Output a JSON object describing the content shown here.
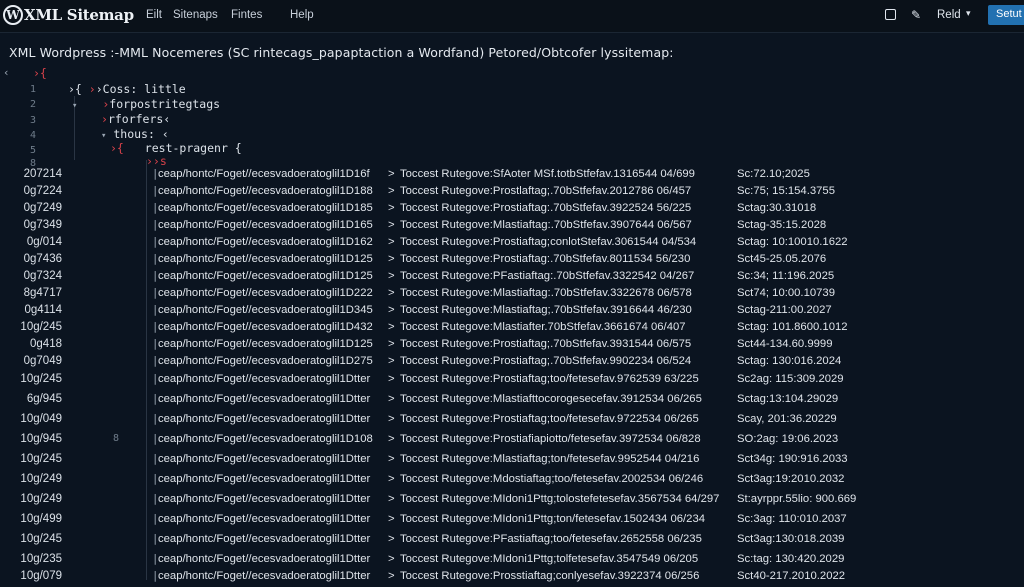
{
  "app": {
    "logo": "W",
    "title": "XML Sitemap"
  },
  "menu": [
    "Eilt",
    "Sitenaps",
    "Fintes",
    "Help"
  ],
  "toolbar": {
    "square_icon": "square-icon",
    "edit_icon": "pencil-icon",
    "read_label": "Reld",
    "caret": "▾",
    "primary_label": "Setut"
  },
  "subtitle": "XML Wordpress :-MML Nocemeres (SC rintecags_papaptaction a Wordfand) Petored/Obtcofer lyssitemap:",
  "tree": {
    "back": "‹",
    "lines": [
      {
        "num": "",
        "pre": "",
        "red": "›{",
        "text": ""
      },
      {
        "num": "1",
        "pre": "›{  ",
        "red": "›",
        "text": "›Coss: little"
      },
      {
        "num": "2",
        "pre": "",
        "red": "›",
        "text": "forpostritegtags"
      },
      {
        "num": "3",
        "pre": "",
        "red": "›",
        "text": "rforfers‹"
      },
      {
        "num": "4",
        "pre": "",
        "red": "",
        "text": "thous: ‹"
      },
      {
        "num": "5",
        "pre": "",
        "red": "›{",
        "text": "rest-pragenr {"
      },
      {
        "num": "8",
        "pre": "",
        "red": "››s",
        "text": ""
      }
    ]
  },
  "rows": [
    {
      "id": "207214",
      "path": "ceap/hontc/Foget//ecesvadoeratoglil1D16f",
      "desc": "Toccest Rutegove:SfAoter MSf.totbStfefav.1316544 04/699",
      "date": "Sc:72.10;2025"
    },
    {
      "id": "0g7224",
      "path": "ceap/hontc/Foget//ecesvadoeratoglil1D188",
      "desc": "Toccest Rutegove:Prostlaftag;.70bStfefav.2012786 06/457",
      "date": "Sc:75; 15:154.3755"
    },
    {
      "id": "0g7249",
      "path": "ceap/hontc/Foget//ecesvadoeratoglil1D185",
      "desc": "Toccest Rutegove:Prostiaftag:.70bStfefav.3922524 56/225",
      "date": "Sctag:30.31018"
    },
    {
      "id": "0g7349",
      "path": "ceap/hontc/Foget//ecesvadoeratoglil1D165",
      "desc": "Toccest Rutegove:Mlastiaftag:.70bStfefav.3907644 06/567",
      "date": "Sctag-35:15.2028"
    },
    {
      "id": "0g/014",
      "path": "ceap/hontc/Foget//ecesvadoeratoglil1D162",
      "desc": "Toccest Rutegove:Prostiaftag;conlotStefav.3061544 04/534",
      "date": "Sctag: 10:10010.1622"
    },
    {
      "id": "0g7436",
      "path": "ceap/hontc/Foget//ecesvadoeratoglil1D125",
      "desc": "Toccest Rutegove:Prostiaftag:.70bStfefav.8011534 56/230",
      "date": "Sct45-25.05.2076"
    },
    {
      "id": "0g7324",
      "path": "ceap/hontc/Foget//ecesvadoeratoglil1D125",
      "desc": "Toccest Rutegove:PFastiaftag:.70bStfefav.3322542 04/267",
      "date": "Sc:34; 11:196.2025"
    },
    {
      "id": "8g4717",
      "path": "ceap/hontc/Foget//ecesvadoeratoglil1D222",
      "desc": "Toccest Rutegove:Mlastiaftag:.70bStfefav.3322678 06/578",
      "date": "Sct74; 10:00.10739"
    },
    {
      "id": "0g4114",
      "path": "ceap/hontc/Foget//ecesvadoeratoglil1D345",
      "desc": "Toccest Rutegove:Mlastiaftag;.70bStfefav.3916644 46/230",
      "date": "Sctag-211:00.2027"
    },
    {
      "id": "10g/245",
      "path": "ceap/hontc/Foget//ecesvadoeratoglil1D432",
      "desc": "Toccest Rutegove:Mlastiafter.70bStfefav.3661674 06/407",
      "date": "Sctag: 101.8600.1012"
    },
    {
      "id": "0g418",
      "path": "ceap/hontc/Foget//ecesvadoeratoglil1D125",
      "desc": "Toccest Rutegove:Prostiaftag;.70bStfefav.3931544 06/575",
      "date": "Sct44-134.60.9999"
    },
    {
      "id": "0g7049",
      "path": "ceap/hontc/Foget//ecesvadoeratoglil1D275",
      "desc": "Toccest Rutegove:Prostiaftag;.70bStfefav.9902234 06/524",
      "date": "Sctag: 130:016.2024"
    },
    {
      "id": "10g/245",
      "path": "ceap/hontc/Foget//ecesvadoeratoglil1Dtter",
      "desc": "Toccest Rutegove:Prostiaftag;too/fetesefav.9762539 63/225",
      "date": "Sc2ag: 115:309.2029"
    },
    {
      "id": "6g/945",
      "path": "ceap/hontc/Foget//ecesvadoeratoglil1Dtter",
      "desc": "Toccest Rutegove:Mlastiafttocorogesecefav.3912534 06/265",
      "date": "Sctag:13:104.29029"
    },
    {
      "id": "10g/049",
      "path": "ceap/hontc/Foget//ecesvadoeratoglil1Dtter",
      "desc": "Toccest Rutegove:Prostiaftag;too/fetesefav.9722534 06/265",
      "date": "Scay, 201:36.20229"
    },
    {
      "id": "10g/945",
      "path": "ceap/hontc/Foget//ecesvadoeratoglil1D108",
      "desc": "Toccest Rutegove:Prostiafiapiotto/fetesefav.3972534 06/828",
      "date": "SO:2ag: 19:06.2023"
    },
    {
      "id": "10g/245",
      "path": "ceap/hontc/Foget//ecesvadoeratoglil1Dtter",
      "desc": "Toccest Rutegove:Mlastiaftag;ton/fetesefav.9952544 04/216",
      "date": "Sct34g: 190:916.2033"
    },
    {
      "id": "10g/249",
      "path": "ceap/hontc/Foget//ecesvadoeratoglil1Dtter",
      "desc": "Toccest Rutegove:Mdostiaftag;too/fetesefav.2002534 06/246",
      "date": "Sct3ag:19:2010.2032"
    },
    {
      "id": "10g/249",
      "path": "ceap/hontc/Foget//ecesvadoeratoglil1Dtter",
      "desc": "Toccest Rutegove:MIdoni1Pttg;tolostefetesefav.3567534 64/297",
      "date": "St:ayrppr.55lio: 900.669"
    },
    {
      "id": "10g/499",
      "path": "ceap/hontc/Foget//ecesvadoeratoglil1Dtter",
      "desc": "Toccest Rutegove:MIdoni1Pttg;ton/fetesefav.1502434 06/234",
      "date": "Sc:3ag: 110:010.2037"
    },
    {
      "id": "10g/245",
      "path": "ceap/hontc/Foget//ecesvadoeratoglil1Dtter",
      "desc": "Toccest Rutegove:PFastiaftag;too/fetesefav.2652558 06/235",
      "date": "Sct3ag:130:018.2039"
    },
    {
      "id": "10g/235",
      "path": "ceap/hontc/Foget//ecesvadoeratoglil1Dtter",
      "desc": "Toccest Rutegove:MIdoni1Pttg;tolfetesefav.3547549 06/205",
      "date": "Sc:tag: 130:420.2029"
    },
    {
      "id": "10g/079",
      "path": "ceap/hontc/Foget//ecesvadoeratoglil1Dtter",
      "desc": "Toccest Rutegove:Prosstiaftag;conlyesefav.3922374 06/256",
      "date": "Sct40-217.2010.2022"
    }
  ],
  "marks": {
    "small": "8"
  }
}
